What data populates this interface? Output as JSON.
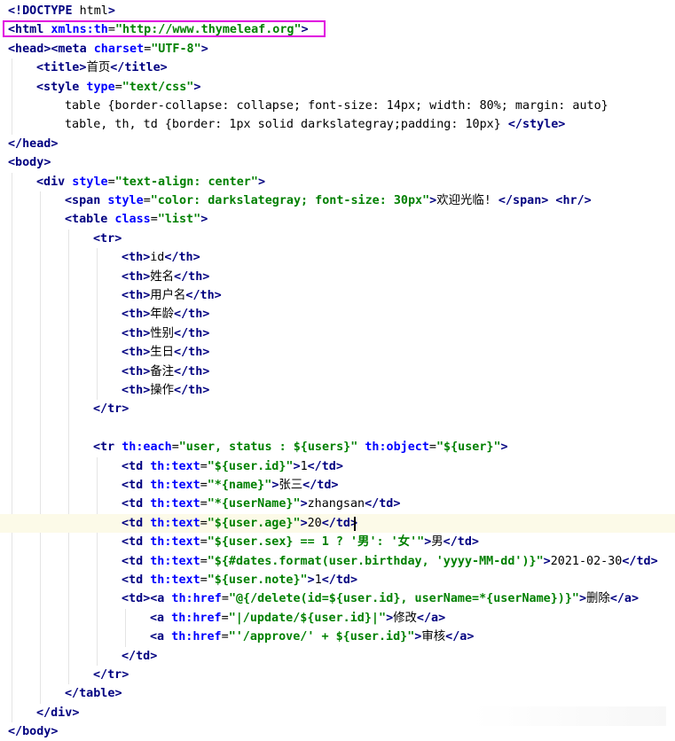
{
  "lines": [
    "<!DOCTYPE html>",
    "<html xmlns:th=\"http://www.thymeleaf.org\">",
    "<head><meta charset=\"UTF-8\">",
    "<title>首页</title>",
    "<style type=\"text/css\">",
    "table {border-collapse: collapse; font-size: 14px; width: 80%; margin: auto}",
    "table, th, td {border: 1px solid darkslategray;padding: 10px} </style>",
    "</head>",
    "<body>",
    "<div style=\"text-align: center\">",
    "<span style=\"color: darkslategray; font-size: 30px\">欢迎光临! </span> <hr/>",
    "<table class=\"list\">",
    "<tr>",
    "<th>id</th>",
    "<th>姓名</th>",
    "<th>用户名</th>",
    "<th>年龄</th>",
    "<th>性别</th>",
    "<th>生日</th>",
    "<th>备注</th>",
    "<th>操作</th>",
    "</tr>",
    "",
    "<tr th:each=\"user, status : ${users}\" th:object=\"${user}\">",
    "<td th:text=\"${user.id}\">1</td>",
    "<td th:text=\"*{name}\">张三</td>",
    "<td th:text=\"*{userName}\">zhangsan</td>",
    "<td th:text=\"${user.age}\">20</td>",
    "<td th:text=\"${user.sex} == 1 ? '男': '女'\">男</td>",
    "<td th:text=\"${#dates.format(user.birthday, 'yyyy-MM-dd')}\">2021-02-30</td>",
    "<td th:text=\"${user.note}\">1</td>",
    "<td><a th:href=\"@{/delete(id=${user.id}, userName=*{userName})}\">删除</a>",
    "<a th:href=\"|/update/${user.id}|\">修改</a>",
    "<a th:href=\"'/approve/' + ${user.id}\">审核</a>",
    "</td>",
    "</tr>",
    "</table>",
    "</div>",
    "</body>"
  ],
  "highlighted_line": 1,
  "caret_line": 27
}
